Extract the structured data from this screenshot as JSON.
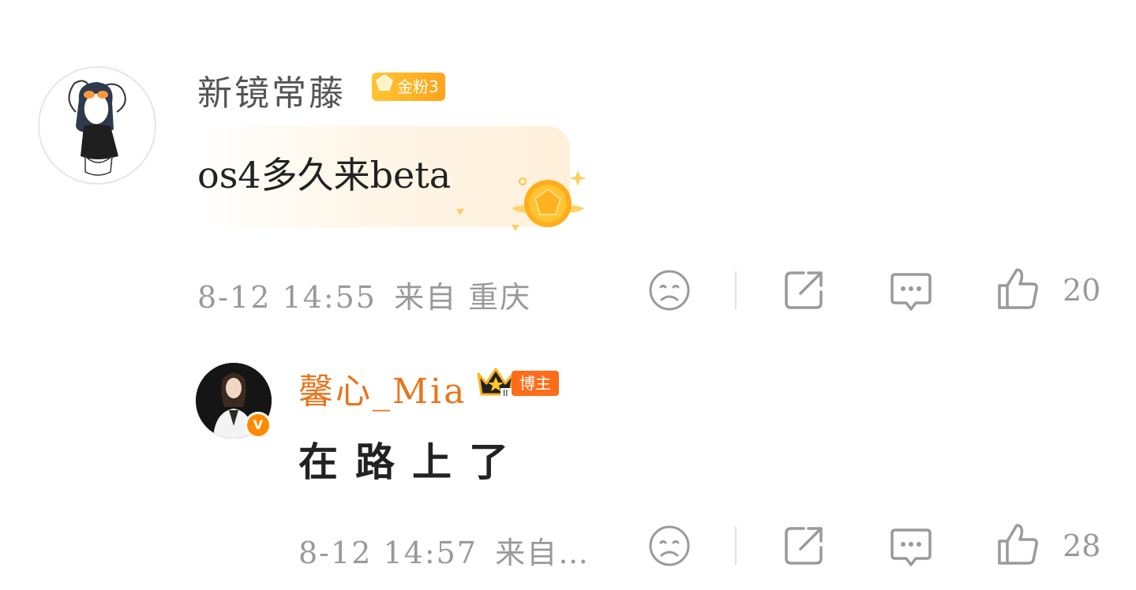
{
  "comment": {
    "username": "新镜常藤",
    "fan_badge": "金粉3",
    "text": "os4多久来beta",
    "date": "8-12",
    "time": "14:55",
    "source": "来自 重庆",
    "like_count": "20"
  },
  "reply": {
    "username": "馨心_Mia",
    "verified_badge": "V",
    "role_badge": "博主",
    "text": "在路上了",
    "date": "8-12",
    "time": "14:57",
    "source": "来自…",
    "like_count": "28"
  },
  "colors": {
    "accent_orange": "#e8741b",
    "badge_gold": "#ffb31f",
    "muted_text": "#999999",
    "icon_gray": "#9a9a9a"
  },
  "icons": [
    "sad-face-icon",
    "share-icon",
    "comment-icon",
    "like-icon",
    "crown-icon",
    "gem-icon"
  ]
}
